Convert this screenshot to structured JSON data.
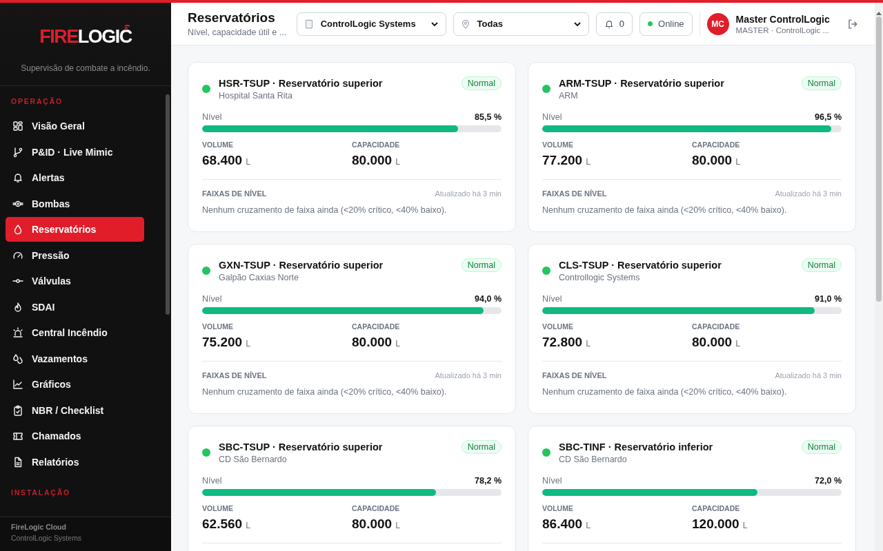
{
  "brand": {
    "logo_red": "FIRE",
    "logo_white": "LOGIC",
    "tagline": "Supervisão de combate a incêndio."
  },
  "sidebar": {
    "sections": [
      {
        "title": "OPERAÇÃO",
        "items": [
          {
            "label": "Visão Geral",
            "kind": "grid",
            "selected": false
          },
          {
            "label": "P&ID · Live Mimic",
            "kind": "branch",
            "selected": false
          },
          {
            "label": "Alertas",
            "kind": "bell",
            "selected": false
          },
          {
            "label": "Bombas",
            "kind": "pump",
            "selected": false
          },
          {
            "label": "Reservatórios",
            "kind": "drop",
            "selected": true
          },
          {
            "label": "Pressão",
            "kind": "gauge",
            "selected": false
          },
          {
            "label": "Válvulas",
            "kind": "valve",
            "selected": false
          },
          {
            "label": "SDAI",
            "kind": "flame",
            "selected": false
          },
          {
            "label": "Central Incêndio",
            "kind": "siren",
            "selected": false
          },
          {
            "label": "Vazamentos",
            "kind": "drops",
            "selected": false
          },
          {
            "label": "Gráficos",
            "kind": "chart",
            "selected": false
          },
          {
            "label": "NBR / Checklist",
            "kind": "clipboard",
            "selected": false
          },
          {
            "label": "Chamados",
            "kind": "ticket",
            "selected": false
          },
          {
            "label": "Relatórios",
            "kind": "file",
            "selected": false
          }
        ]
      },
      {
        "title": "INSTALAÇÃO"
      }
    ],
    "footer": {
      "title": "FireLogic Cloud",
      "subtitle": "ControlLogic Systems"
    }
  },
  "header": {
    "title": "Reservatórios",
    "subtitle": "Nível, capacidade útil e ...",
    "company_select": "ControlLogic Systems",
    "location_select": "Todas",
    "notifications": "0",
    "status": "Online",
    "user": {
      "initials": "MC",
      "name": "Master ControlLogic",
      "role": "MASTER · ControlLogic ..."
    }
  },
  "cards": [
    {
      "title": "HSR-TSUP · Reservatório superior",
      "site": "Hospital Santa Rita",
      "badge": "Normal",
      "color": "#22c55e",
      "level_label": "Nível",
      "reading": "85,5 %",
      "level": 0.855,
      "volume_label": "VOLUME",
      "volume": "68.400",
      "volume_unit": "L",
      "capacity_label": "CAPACIDADE",
      "capacity": "80.000",
      "capacity_unit": "L",
      "bands_title": "FAIXAS DE NÍVEL",
      "updated": "Atualizado há 3 min",
      "bands_text": "Nenhum cruzamento de faixa ainda (<20% crítico, <40% baixo)."
    },
    {
      "title": "ARM-TSUP · Reservatório superior",
      "site": "ARM",
      "badge": "Normal",
      "color": "#22c55e",
      "level_label": "Nível",
      "reading": "96,5 %",
      "level": 0.965,
      "volume_label": "VOLUME",
      "volume": "77.200",
      "volume_unit": "L",
      "capacity_label": "CAPACIDADE",
      "capacity": "80.000",
      "capacity_unit": "L",
      "bands_title": "FAIXAS DE NÍVEL",
      "updated": "Atualizado há 3 min",
      "bands_text": "Nenhum cruzamento de faixa ainda (<20% crítico, <40% baixo)."
    },
    {
      "title": "GXN-TSUP · Reservatório superior",
      "site": "Galpão Caxias Norte",
      "badge": "Normal",
      "color": "#22c55e",
      "level_label": "Nível",
      "reading": "94,0 %",
      "level": 0.94,
      "volume_label": "VOLUME",
      "volume": "75.200",
      "volume_unit": "L",
      "capacity_label": "CAPACIDADE",
      "capacity": "80.000",
      "capacity_unit": "L",
      "bands_title": "FAIXAS DE NÍVEL",
      "updated": "Atualizado há 3 min",
      "bands_text": "Nenhum cruzamento de faixa ainda (<20% crítico, <40% baixo)."
    },
    {
      "title": "CLS-TSUP · Reservatório superior",
      "site": "Controllogic Systems",
      "badge": "Normal",
      "color": "#22c55e",
      "level_label": "Nível",
      "reading": "91,0 %",
      "level": 0.91,
      "volume_label": "VOLUME",
      "volume": "72.800",
      "volume_unit": "L",
      "capacity_label": "CAPACIDADE",
      "capacity": "80.000",
      "capacity_unit": "L",
      "bands_title": "FAIXAS DE NÍVEL",
      "updated": "Atualizado há 3 min",
      "bands_text": "Nenhum cruzamento de faixa ainda (<20% crítico, <40% baixo)."
    },
    {
      "title": "SBC-TSUP · Reservatório superior",
      "site": "CD São Bernardo",
      "badge": "Normal",
      "color": "#22c55e",
      "level_label": "Nível",
      "reading": "78,2 %",
      "level": 0.782,
      "volume_label": "VOLUME",
      "volume": "62.560",
      "volume_unit": "L",
      "capacity_label": "CAPACIDADE",
      "capacity": "80.000",
      "capacity_unit": "L"
    },
    {
      "title": "SBC-TINF · Reservatório inferior",
      "site": "CD São Bernardo",
      "badge": "Normal",
      "color": "#22c55e",
      "level_label": "Nível",
      "reading": "72,0 %",
      "level": 0.72,
      "volume_label": "VOLUME",
      "volume": "86.400",
      "volume_unit": "L",
      "capacity_label": "CAPACIDADE",
      "capacity": "120.000",
      "capacity_unit": "L"
    }
  ]
}
